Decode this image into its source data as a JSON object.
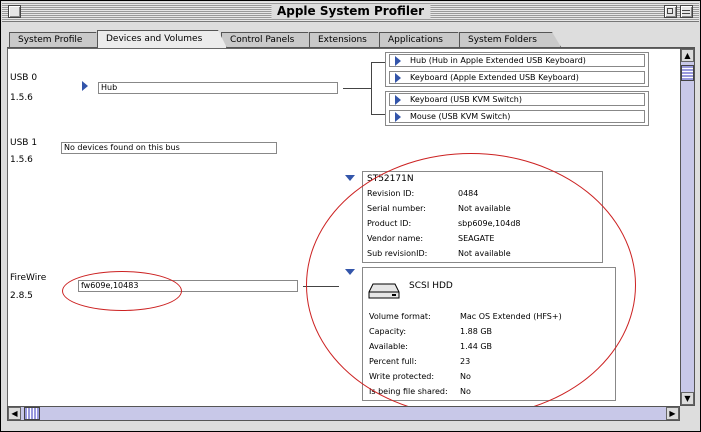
{
  "window": {
    "title": "Apple System Profiler"
  },
  "tabs": [
    {
      "label": "System Profile"
    },
    {
      "label": "Devices and Volumes"
    },
    {
      "label": "Control Panels"
    },
    {
      "label": "Extensions"
    },
    {
      "label": "Applications"
    },
    {
      "label": "System Folders"
    }
  ],
  "buses": {
    "usb0": {
      "name": "USB 0",
      "version": "1.5.6",
      "device": "Hub"
    },
    "usb1": {
      "name": "USB 1",
      "version": "1.5.6",
      "device": "No devices found on this bus"
    },
    "firewire": {
      "name": "FireWire",
      "version": "2.8.5",
      "device": "fw609e,10483"
    }
  },
  "usb_devices": [
    "Hub (Hub in Apple Extended USB Keyboard)",
    "Keyboard (Apple Extended USB Keyboard)",
    "Keyboard (USB KVM Switch)",
    "Mouse (USB KVM Switch)"
  ],
  "firewire_device": {
    "name": "ST52171N",
    "props": [
      {
        "k": "Revision ID:",
        "v": "0484"
      },
      {
        "k": "Serial number:",
        "v": "Not available"
      },
      {
        "k": "Product ID:",
        "v": "sbp609e,104d8"
      },
      {
        "k": "Vendor name:",
        "v": "SEAGATE"
      },
      {
        "k": "Sub revisionID:",
        "v": "Not available"
      }
    ]
  },
  "volume": {
    "name": "SCSI HDD",
    "props": [
      {
        "k": "Volume format:",
        "v": "Mac OS Extended (HFS+)"
      },
      {
        "k": "Capacity:",
        "v": "1.88 GB"
      },
      {
        "k": "Available:",
        "v": "1.44 GB"
      },
      {
        "k": "Percent full:",
        "v": "23"
      },
      {
        "k": "Write protected:",
        "v": "No"
      },
      {
        "k": "Is being file shared:",
        "v": "No"
      }
    ]
  },
  "colors": {
    "accent": "#3355aa",
    "annotation": "#cc2222",
    "scrollbar": "#9999dd"
  },
  "icons": {
    "disclosure": "triangle-icon",
    "disk": "hard-disk-icon"
  }
}
